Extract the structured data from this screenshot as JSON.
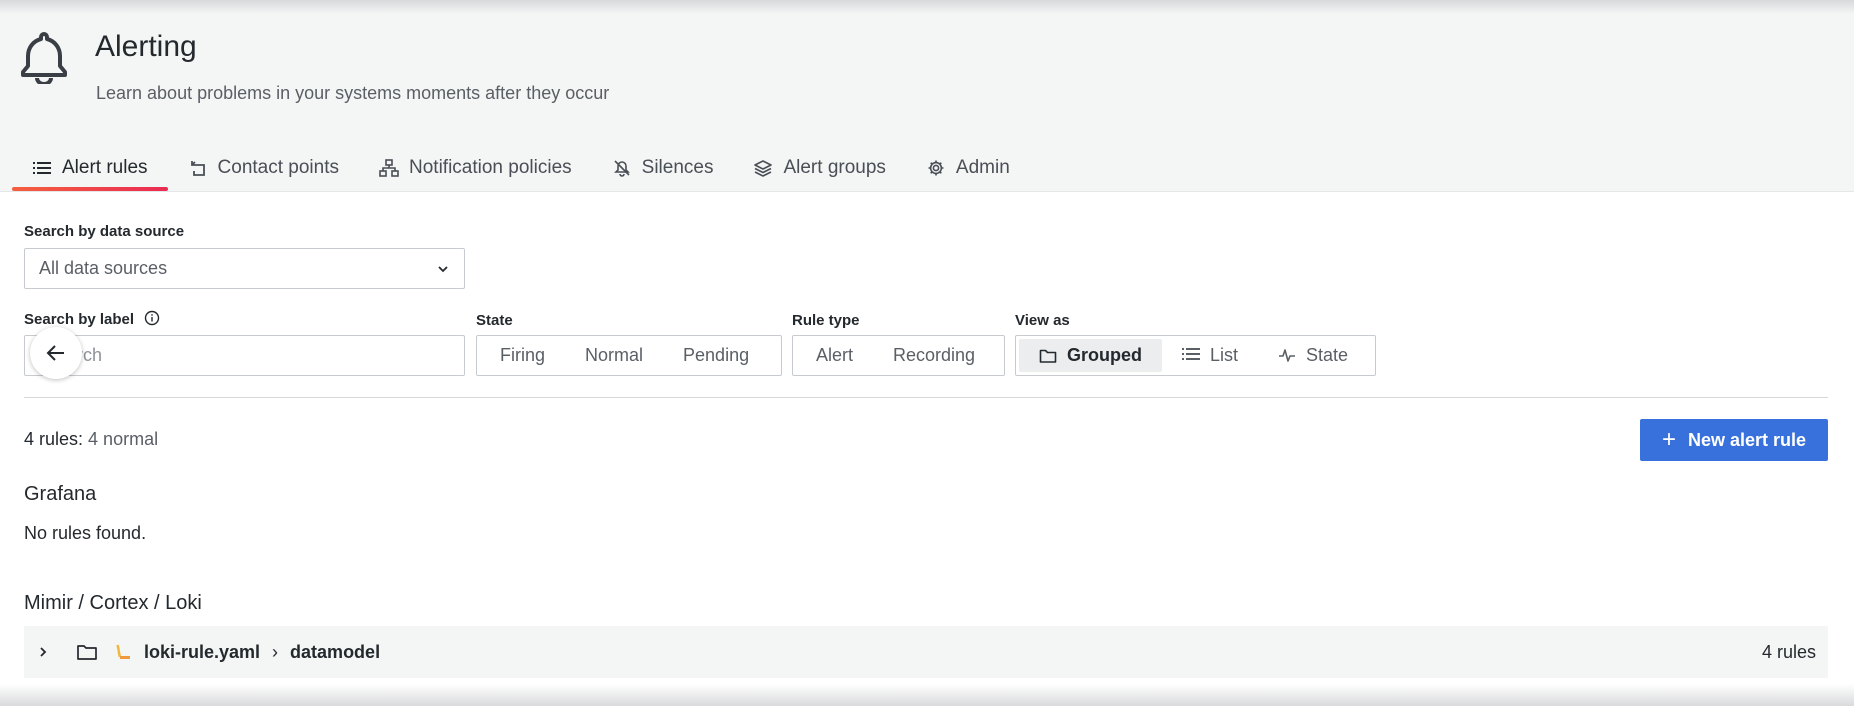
{
  "header": {
    "title": "Alerting",
    "subtitle": "Learn about problems in your systems moments after they occur",
    "icon": "bell-icon"
  },
  "tabs": [
    {
      "label": "Alert rules",
      "icon": "list-icon",
      "active": true
    },
    {
      "label": "Contact points",
      "icon": "contact-icon"
    },
    {
      "label": "Notification policies",
      "icon": "sitemap-icon"
    },
    {
      "label": "Silences",
      "icon": "bell-slash-icon"
    },
    {
      "label": "Alert groups",
      "icon": "layer-group-icon"
    },
    {
      "label": "Admin",
      "icon": "cog-icon"
    }
  ],
  "filters": {
    "datasource_label": "Search by data source",
    "datasource_value": "All data sources",
    "label_label": "Search by label",
    "search_placeholder": "Search",
    "state_label": "State",
    "state_options": [
      "Firing",
      "Normal",
      "Pending"
    ],
    "ruletype_label": "Rule type",
    "ruletype_options": [
      "Alert",
      "Recording"
    ],
    "viewas_label": "View as",
    "viewas_options": [
      "Grouped",
      "List",
      "State"
    ],
    "viewas_selected": "Grouped"
  },
  "summary": {
    "count": "4 rules:",
    "detail": "4 normal"
  },
  "actions": {
    "new_rule": "New alert rule"
  },
  "sections": {
    "grafana_title": "Grafana",
    "grafana_empty": "No rules found.",
    "external_title": "Mimir / Cortex / Loki"
  },
  "namespace": {
    "name": "loki-rule.yaml",
    "separator": "›",
    "group": "datamodel",
    "rule_count": "4 rules"
  },
  "colors": {
    "accent": "#3871dc",
    "tab_underline_start": "#f55f3e",
    "tab_underline_end": "#ea2b54"
  }
}
